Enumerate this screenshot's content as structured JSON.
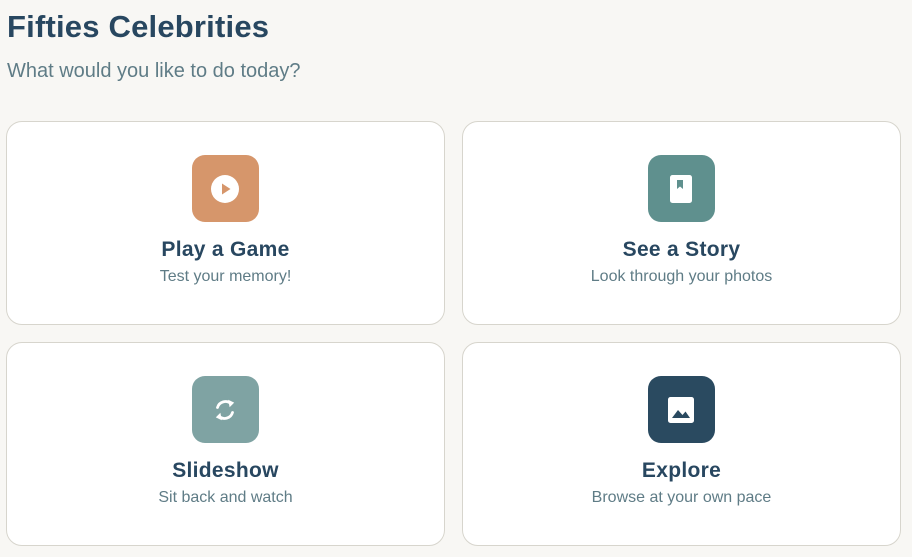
{
  "header": {
    "title": "Fifties Celebrities",
    "subtitle": "What would you like to do today?"
  },
  "cards": [
    {
      "title": "Play a Game",
      "description": "Test your memory!",
      "icon": "play-circle-icon",
      "color": "#d6966b"
    },
    {
      "title": "See a Story",
      "description": "Look through your photos",
      "icon": "book-icon",
      "color": "#5f908e"
    },
    {
      "title": "Slideshow",
      "description": "Sit back and watch",
      "icon": "sync-icon",
      "color": "#7fa3a3"
    },
    {
      "title": "Explore",
      "description": "Browse at your own pace",
      "icon": "image-icon",
      "color": "#2a4a60"
    }
  ]
}
